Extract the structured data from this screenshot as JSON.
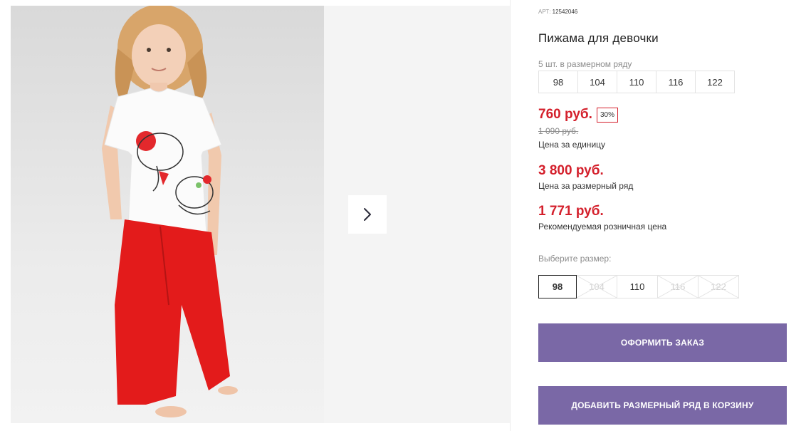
{
  "gallery": {
    "next_icon": "chevron-right-icon"
  },
  "product": {
    "art_label": "АРТ:",
    "art_value": "12542046",
    "title": "Пижама для девочки",
    "pack_note": "5 шт. в размерном ряду",
    "pack_sizes": [
      "98",
      "104",
      "110",
      "116",
      "122"
    ],
    "price": "760 руб.",
    "discount": "30%",
    "old_price": "1 090 руб.",
    "unit_label": "Цена за единицу",
    "range_price": "3 800 руб.",
    "range_label": "Цена за размерный ряд",
    "retail_price": "1 771 руб.",
    "retail_label": "Рекомендуемая розничная цена"
  },
  "size_picker": {
    "label": "Выберите размер:",
    "options": [
      {
        "label": "98",
        "state": "selected"
      },
      {
        "label": "104",
        "state": "disabled"
      },
      {
        "label": "110",
        "state": "available"
      },
      {
        "label": "116",
        "state": "disabled"
      },
      {
        "label": "122",
        "state": "disabled"
      }
    ]
  },
  "actions": {
    "order_label": "ОФОРМИТЬ ЗАКАЗ",
    "cart_label": "ДОБАВИТЬ РАЗМЕРНЫЙ РЯД В КОРЗИНУ"
  },
  "colors": {
    "price_red": "#d4202c",
    "button_purple": "#7a68a6"
  }
}
